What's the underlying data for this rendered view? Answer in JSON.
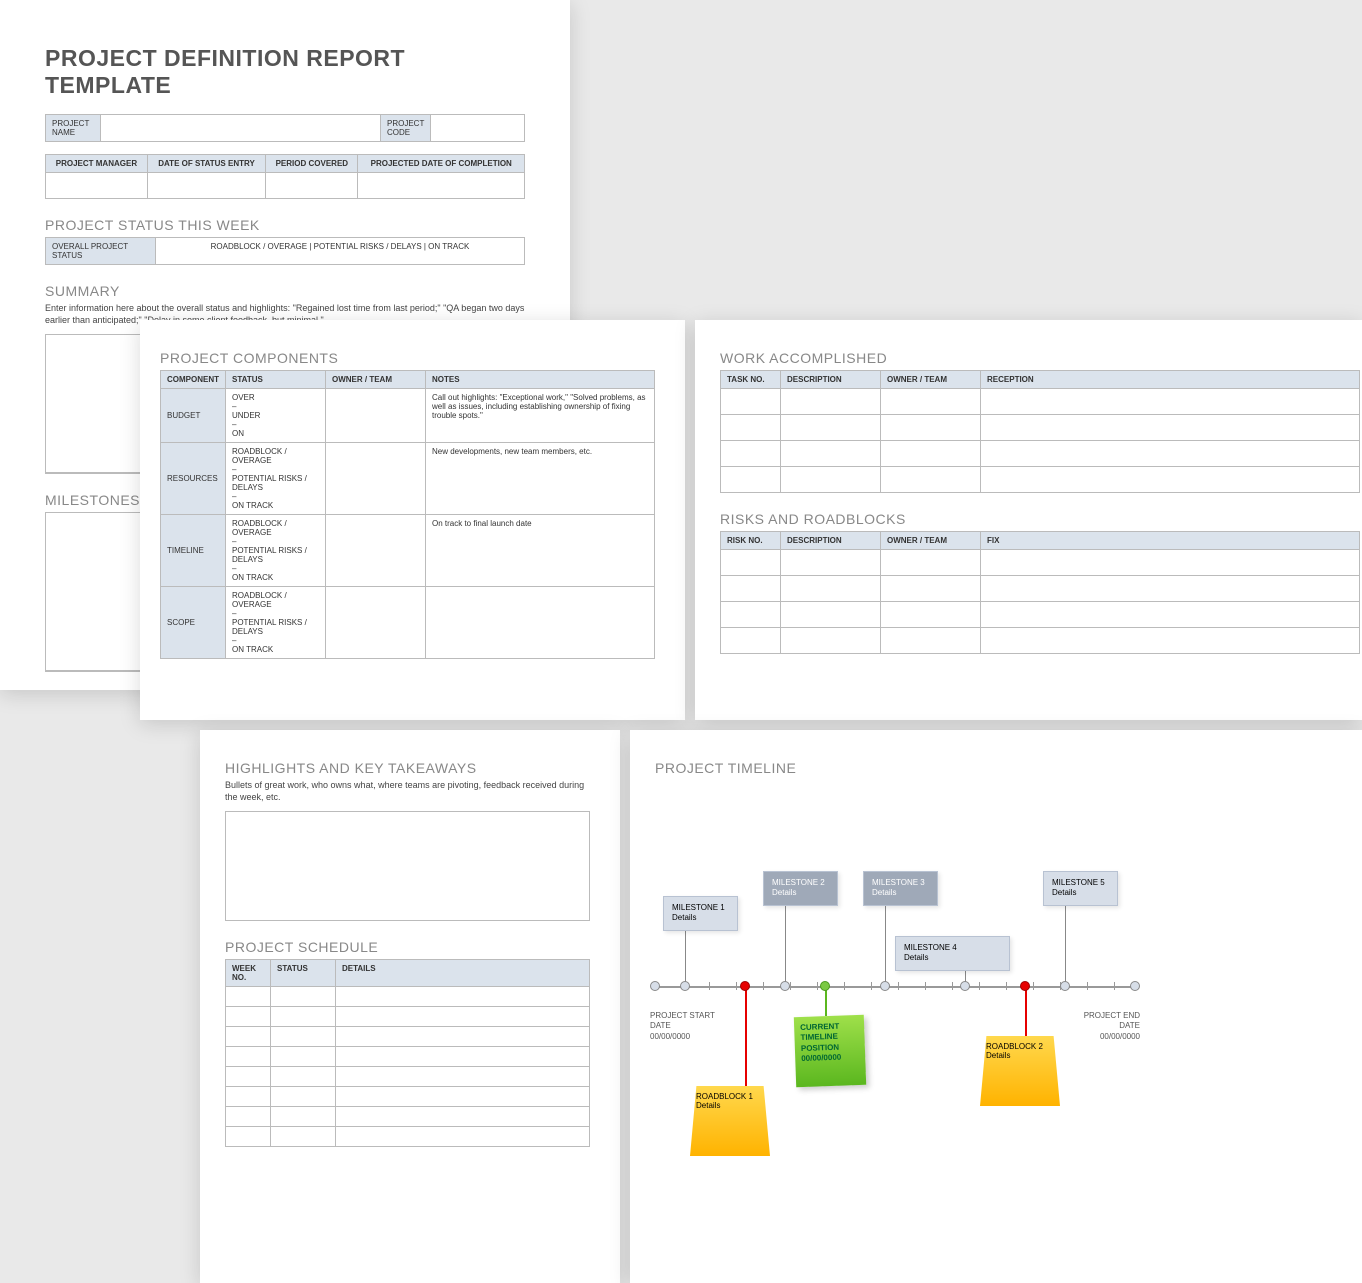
{
  "page1": {
    "title": "PROJECT DEFINITION REPORT TEMPLATE",
    "hdr": {
      "name": "PROJECT NAME",
      "code": "PROJECT CODE"
    },
    "cols": [
      "PROJECT MANAGER",
      "DATE OF STATUS ENTRY",
      "PERIOD COVERED",
      "PROJECTED DATE OF COMPLETION"
    ],
    "status_title": "PROJECT STATUS THIS WEEK",
    "status_label": "OVERALL PROJECT STATUS",
    "status_opts": "ROADBLOCK / OVERAGE    |    POTENTIAL RISKS / DELAYS    |    ON TRACK",
    "summary_title": "SUMMARY",
    "summary_desc": "Enter information here about the overall status and highlights: \"Regained lost time from last period;\" \"QA began two days earlier than anticipated;\" \"Delay in some client feedback, but minimal.\"",
    "milestones_title": "MILESTONES"
  },
  "page2": {
    "title": "PROJECT COMPONENTS",
    "cols": [
      "COMPONENT",
      "STATUS",
      "OWNER / TEAM",
      "NOTES"
    ],
    "rows": [
      {
        "c": "BUDGET",
        "s": "OVER\n–\nUNDER\n–\nON",
        "n": "Call out highlights: \"Exceptional work,\" \"Solved problems, as well as issues, including establishing ownership of fixing trouble spots.\""
      },
      {
        "c": "RESOURCES",
        "s": "ROADBLOCK / OVERAGE\n–\nPOTENTIAL RISKS / DELAYS\n–\nON TRACK",
        "n": "New developments, new team members, etc."
      },
      {
        "c": "TIMELINE",
        "s": "ROADBLOCK / OVERAGE\n–\nPOTENTIAL RISKS / DELAYS\n–\nON TRACK",
        "n": "On track to final launch date"
      },
      {
        "c": "SCOPE",
        "s": "ROADBLOCK / OVERAGE\n–\nPOTENTIAL RISKS / DELAYS\n–\nON TRACK",
        "n": ""
      }
    ]
  },
  "page3": {
    "work_title": "WORK ACCOMPLISHED",
    "work_cols": [
      "TASK NO.",
      "DESCRIPTION",
      "OWNER / TEAM",
      "RECEPTION"
    ],
    "risk_title": "RISKS AND ROADBLOCKS",
    "risk_cols": [
      "RISK NO.",
      "DESCRIPTION",
      "OWNER / TEAM",
      "FIX"
    ]
  },
  "page4": {
    "hl_title": "HIGHLIGHTS AND KEY TAKEAWAYS",
    "hl_desc": "Bullets of great work, who owns what, where teams are pivoting, feedback received during the week, etc.",
    "sched_title": "PROJECT SCHEDULE",
    "sched_cols": [
      "WEEK NO.",
      "STATUS",
      "DETAILS"
    ]
  },
  "page5": {
    "title": "PROJECT TIMELINE",
    "start_label": "PROJECT START DATE",
    "start_date": "00/00/0000",
    "end_label": "PROJECT END DATE",
    "end_date": "00/00/0000",
    "ms": [
      {
        "t": "MILESTONE 1",
        "d": "Details"
      },
      {
        "t": "MILESTONE 2",
        "d": "Details"
      },
      {
        "t": "MILESTONE 3",
        "d": "Details"
      },
      {
        "t": "MILESTONE 4",
        "d": "Details"
      },
      {
        "t": "MILESTONE 5",
        "d": "Details"
      }
    ],
    "cur": {
      "l1": "CURRENT",
      "l2": "TIMELINE",
      "l3": "POSITION",
      "l4": "00/00/0000"
    },
    "rb": [
      {
        "t": "ROADBLOCK 1",
        "d": "Details"
      },
      {
        "t": "ROADBLOCK 2",
        "d": "Details"
      }
    ]
  }
}
